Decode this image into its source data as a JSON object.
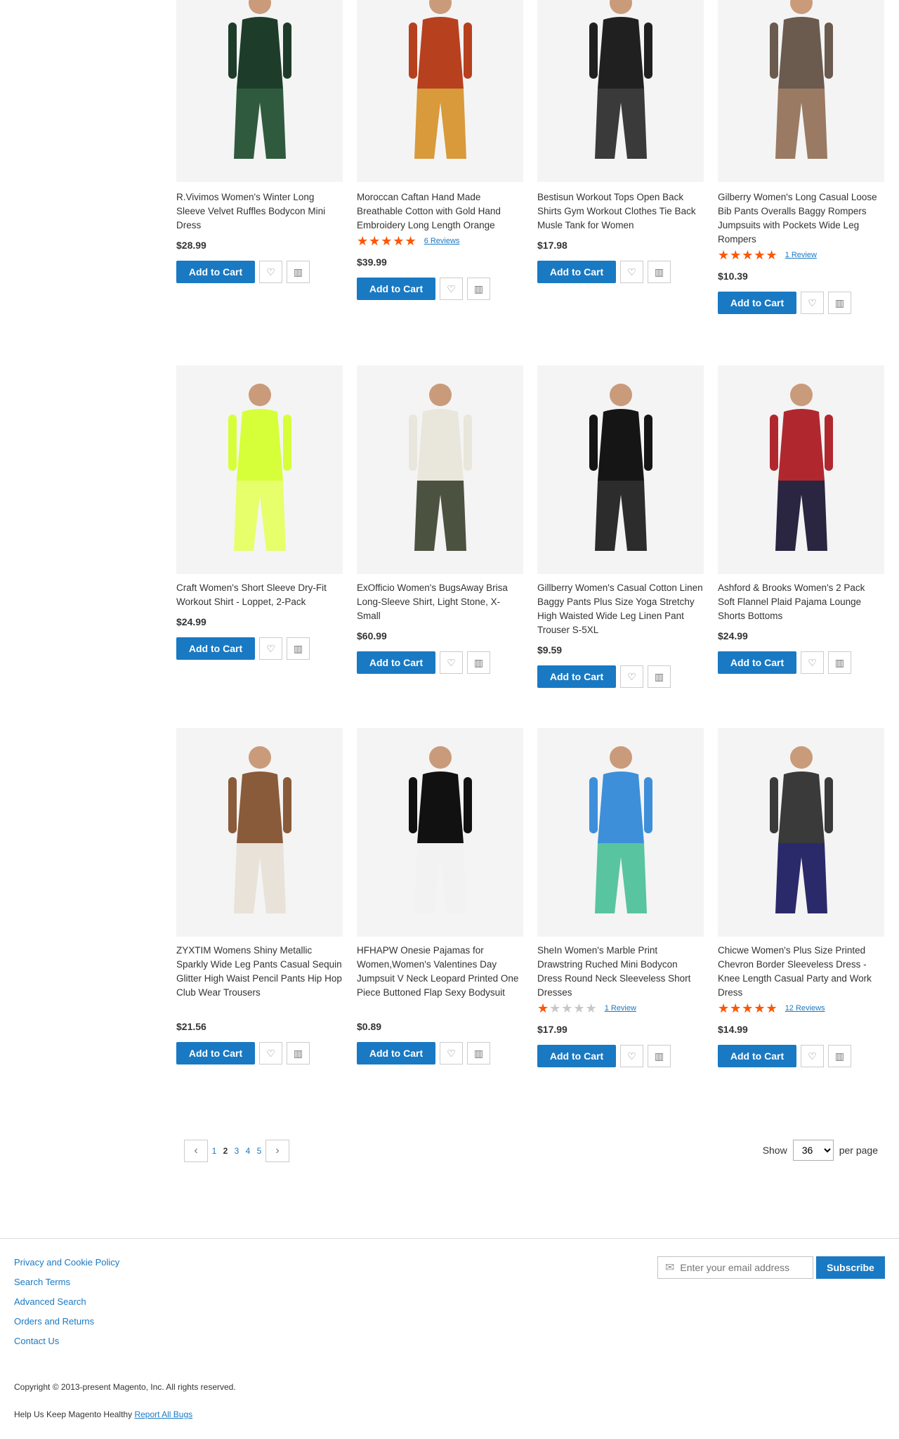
{
  "products": [
    {
      "title": "R.Vivimos Women's Winter Long Sleeve Velvet Ruffles Bodycon Mini Dress",
      "price": "$28.99",
      "rating": null,
      "reviews": null,
      "image_colors": [
        "#1d3d2a",
        "#2f5a3e"
      ]
    },
    {
      "title": "Moroccan Caftan Hand Made Breathable Cotton with Gold Hand Embroidery Long Length Orange",
      "price": "$39.99",
      "rating": 1.0,
      "reviews": "6  Reviews",
      "image_colors": [
        "#b7401f",
        "#d89a3a"
      ]
    },
    {
      "title": "Bestisun Workout Tops Open Back Shirts Gym Workout Clothes Tie Back Musle Tank for Women",
      "price": "$17.98",
      "rating": null,
      "reviews": null,
      "image_colors": [
        "#202020",
        "#3a3a3a"
      ]
    },
    {
      "title": "Gilberry Women's Long Casual Loose Bib Pants Overalls Baggy Rompers Jumpsuits with Pockets Wide Leg Rompers",
      "price": "$10.39",
      "rating": 1.0,
      "reviews": "1  Review",
      "image_colors": [
        "#6b5a4e",
        "#9a7a63"
      ]
    },
    {
      "title": "Craft Women's Short Sleeve Dry-Fit Workout Shirt - Loppet, 2-Pack",
      "price": "$24.99",
      "rating": null,
      "reviews": null,
      "image_colors": [
        "#d6ff3a",
        "#e6ff6a"
      ]
    },
    {
      "title": "ExOfficio Women's BugsAway Brisa Long-Sleeve Shirt, Light Stone, X-Small",
      "price": "$60.99",
      "rating": null,
      "reviews": null,
      "image_colors": [
        "#e9e6dc",
        "#4b5240"
      ]
    },
    {
      "title": "Gillberry Women's Casual Cotton Linen Baggy Pants Plus Size Yoga Stretchy High Waisted Wide Leg Linen Pant Trouser S-5XL",
      "price": "$9.59",
      "rating": null,
      "reviews": null,
      "image_colors": [
        "#151515",
        "#2c2c2c"
      ]
    },
    {
      "title": "Ashford & Brooks Women's 2 Pack Soft Flannel Plaid Pajama Lounge Shorts Bottoms",
      "price": "$24.99",
      "rating": null,
      "reviews": null,
      "image_colors": [
        "#b0282e",
        "#2a2540"
      ]
    },
    {
      "title": "ZYXTIM Womens Shiny Metallic Sparkly Wide Leg Pants Casual Sequin Glitter High Waist Pencil Pants Hip Hop Club Wear Trousers",
      "price": "$21.56",
      "rating": null,
      "reviews": null,
      "image_colors": [
        "#8a5b3a",
        "#e8e2d8"
      ]
    },
    {
      "title": "HFHAPW Onesie Pajamas for Women,Women's Valentines Day Jumpsuit V Neck Leopard Printed One Piece Buttoned Flap Sexy Bodysuit",
      "price": "$0.89",
      "rating": null,
      "reviews": null,
      "image_colors": [
        "#111111",
        "#f2f2f2"
      ]
    },
    {
      "title": "SheIn Women's Marble Print Drawstring Ruched Mini Bodycon Dress Round Neck Sleeveless Short Dresses",
      "price": "$17.99",
      "rating": 0.2,
      "reviews": "1  Review",
      "image_colors": [
        "#3d8fd9",
        "#58c4a0"
      ]
    },
    {
      "title": "Chicwe Women's Plus Size Printed Chevron Border Sleeveless Dress - Knee Length Casual Party and Work Dress",
      "price": "$14.99",
      "rating": 1.0,
      "reviews": "12  Reviews",
      "image_colors": [
        "#3a3a3a",
        "#2a2a6a"
      ]
    }
  ],
  "labels": {
    "add_to_cart": "Add to Cart",
    "star_glyphs": "★★★★★"
  },
  "pager": {
    "pages": [
      "1",
      "2",
      "3",
      "4",
      "5"
    ],
    "current_index": 1,
    "show_label": "Show",
    "per_page_value": "36",
    "per_page_options": [
      "36"
    ],
    "per_page_label": "per page"
  },
  "footer": {
    "links": [
      "Privacy and Cookie Policy",
      "Search Terms",
      "Advanced Search",
      "Orders and Returns",
      "Contact Us"
    ],
    "newsletter_placeholder": "Enter your email address",
    "subscribe_label": "Subscribe",
    "copyright": "Copyright © 2013-present Magento, Inc. All rights reserved.",
    "bugs_text": "Help Us Keep Magento Healthy",
    "bugs_link": "Report All Bugs"
  },
  "colors": {
    "accent": "#1979c3",
    "star_filled": "#ff5501",
    "star_empty": "#c7c7c7"
  }
}
